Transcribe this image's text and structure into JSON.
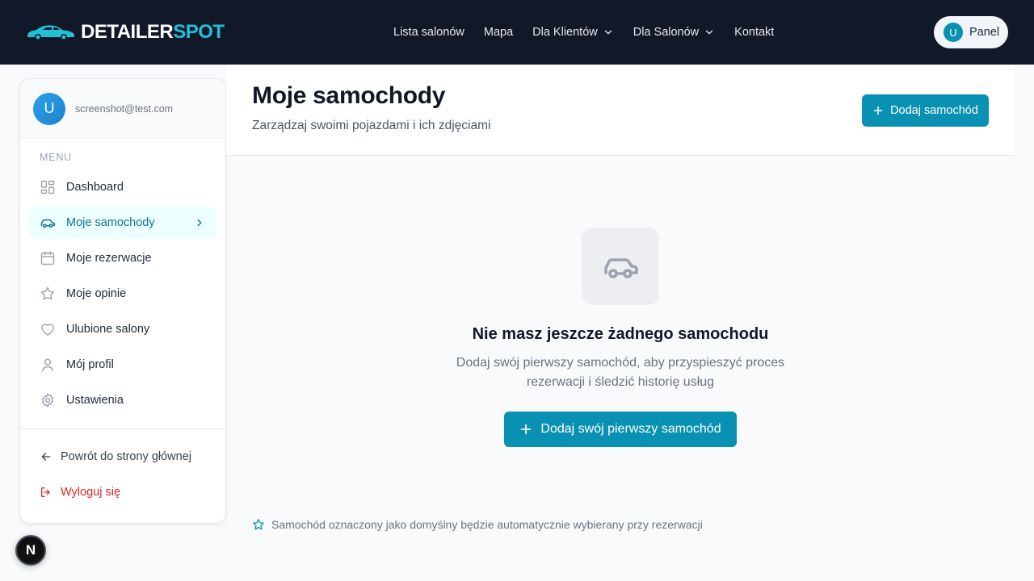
{
  "brand": {
    "name_part1": "DETAILER",
    "name_part2": "SPOT",
    "accent_color": "#22c0d8"
  },
  "nav": {
    "items": [
      {
        "label": "Lista salonów",
        "dropdown": false
      },
      {
        "label": "Mapa",
        "dropdown": false
      },
      {
        "label": "Dla Klientów",
        "dropdown": true
      },
      {
        "label": "Dla Salonów",
        "dropdown": true
      },
      {
        "label": "Kontakt",
        "dropdown": false
      }
    ],
    "panel": {
      "avatar_letter": "U",
      "label": "Panel"
    }
  },
  "sidebar": {
    "user": {
      "avatar_letter": "U",
      "email": "screenshot@test.com"
    },
    "menu_label": "MENU",
    "items": [
      {
        "label": "Dashboard",
        "icon": "grid-icon",
        "active": false
      },
      {
        "label": "Moje samochody",
        "icon": "car-icon",
        "active": true
      },
      {
        "label": "Moje rezerwacje",
        "icon": "calendar-icon",
        "active": false
      },
      {
        "label": "Moje opinie",
        "icon": "star-icon",
        "active": false
      },
      {
        "label": "Ulubione salony",
        "icon": "heart-icon",
        "active": false
      },
      {
        "label": "Mój profil",
        "icon": "user-icon",
        "active": false
      },
      {
        "label": "Ustawienia",
        "icon": "gear-icon",
        "active": false
      }
    ],
    "footer": {
      "back_label": "Powrót do strony głównej",
      "logout_label": "Wyloguj się"
    }
  },
  "main": {
    "title": "Moje samochody",
    "subtitle": "Zarządzaj swoimi pojazdami i ich zdjęciami",
    "add_button_label": "Dodaj samochód",
    "empty_state": {
      "title": "Nie masz jeszcze żadnego samochodu",
      "description": "Dodaj swój pierwszy samochód, aby przyspieszyć proces rezerwacji i śledzić historię usług",
      "cta_label": "Dodaj swój pierwszy samochód"
    },
    "hint": "Samochód oznaczony jako domyślny będzie automatycznie wybierany przy rezerwacji"
  },
  "dev_badge": {
    "letter": "N"
  },
  "colors": {
    "primary": "#0891b2",
    "nav_bg": "#111827",
    "danger": "#dc2626",
    "active_bg": "#ecfeff"
  }
}
